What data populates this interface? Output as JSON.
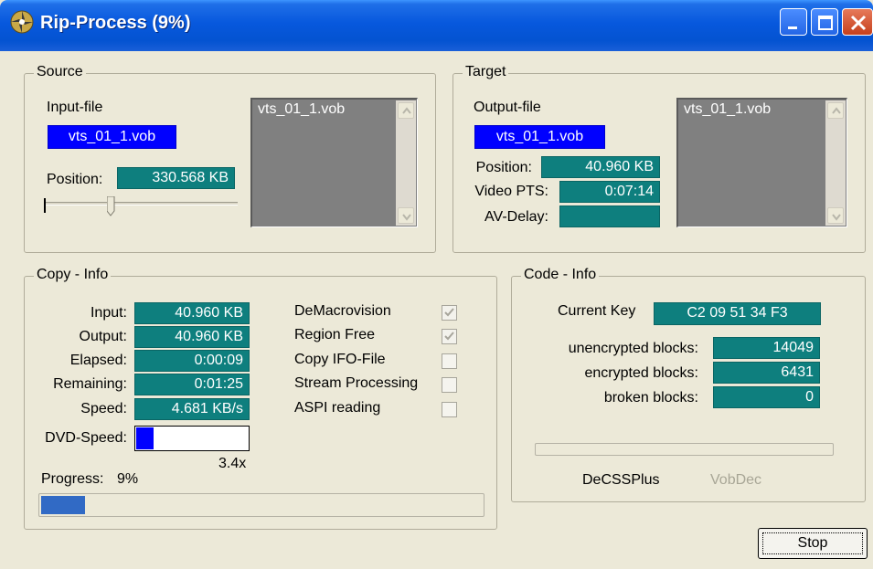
{
  "window": {
    "title": "Rip-Process (9%)"
  },
  "source": {
    "legend": "Source",
    "input_label": "Input-file",
    "input_value": "vts_01_1.vob",
    "position_label": "Position:",
    "position_value": "330.568 KB",
    "position_slider_fraction": 0.34,
    "list_items": [
      "vts_01_1.vob"
    ]
  },
  "target": {
    "legend": "Target",
    "output_label": "Output-file",
    "output_value": "vts_01_1.vob",
    "position_label": "Position:",
    "position_value": "40.960 KB",
    "video_pts_label": "Video PTS:",
    "video_pts_value": "0:07:14",
    "av_delay_label": "AV-Delay:",
    "av_delay_value": "",
    "list_items": [
      "vts_01_1.vob"
    ]
  },
  "copy_info": {
    "legend": "Copy - Info",
    "rows": [
      {
        "label": "Input:",
        "value": "40.960 KB"
      },
      {
        "label": "Output:",
        "value": "40.960 KB"
      },
      {
        "label": "Elapsed:",
        "value": "0:00:09"
      },
      {
        "label": "Remaining:",
        "value": "0:01:25"
      },
      {
        "label": "Speed:",
        "value": "4.681 KB/s"
      }
    ],
    "dvd_speed_label": "DVD-Speed:",
    "dvd_speed_value": "3.4x",
    "dvd_speed_fraction": 0.15,
    "options": [
      {
        "label": "DeMacrovision",
        "checked": true,
        "enabled": false
      },
      {
        "label": "Region Free",
        "checked": true,
        "enabled": false
      },
      {
        "label": "Copy IFO-File",
        "checked": false,
        "enabled": false
      },
      {
        "label": "Stream Processing",
        "checked": false,
        "enabled": false
      },
      {
        "label": "ASPI reading",
        "checked": false,
        "enabled": false
      }
    ],
    "progress_label": "Progress:",
    "progress_text": "9%",
    "progress_fraction": 0.09
  },
  "code_info": {
    "legend": "Code - Info",
    "current_key_label": "Current Key",
    "current_key_value": "C2 09 51 34 F3",
    "unencrypted_label": "unencrypted blocks:",
    "unencrypted_value": "14049",
    "encrypted_label": "encrypted blocks:",
    "encrypted_value": "6431",
    "broken_label": "broken blocks:",
    "broken_value": "0",
    "decss_label": "DeCSSPlus",
    "vobdec_label": "VobDec",
    "progress_fraction": 0
  },
  "buttons": {
    "stop": "Stop"
  },
  "colors": {
    "teal": "#0e7f7e",
    "highlight_blue": "#0000ff",
    "progress_blue": "#316ac5",
    "window_bg": "#ece9d8"
  },
  "icons": {
    "app": "dvd-disc-icon",
    "minimize": "minimize-icon",
    "maximize": "maximize-icon",
    "close": "close-icon",
    "scroll_up": "scroll-up-arrow-icon",
    "scroll_down": "scroll-down-arrow-icon",
    "checkmark": "checkmark-icon"
  }
}
